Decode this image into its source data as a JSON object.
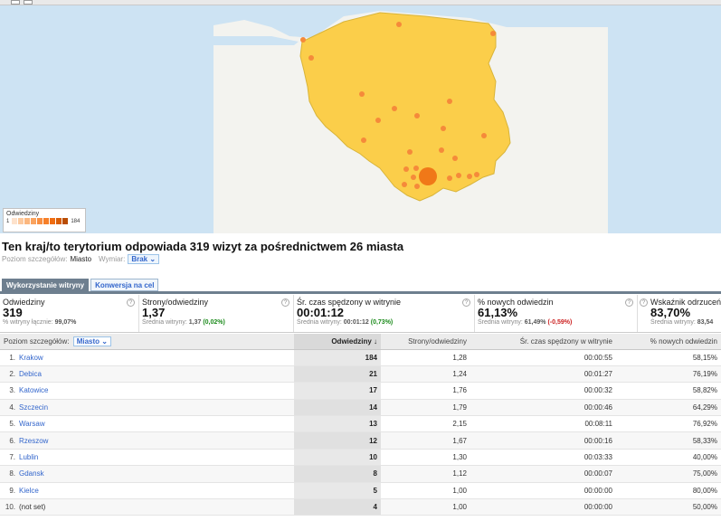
{
  "legend": {
    "title": "Odwiedziny",
    "min": "1",
    "max": "184"
  },
  "heading": "Ten kraj/to terytorium odpowiada 319 wizyt za pośrednictwem 26 miasta",
  "detail": {
    "level_label": "Poziom szczegółów:",
    "level_value": "Miasto",
    "dimension_label": "Wymiar:",
    "dimension_value": "Brak"
  },
  "tabs": [
    "Wykorzystanie witryny",
    "Konwersja na cel"
  ],
  "metrics": [
    {
      "title": "Odwiedziny",
      "value": "319",
      "sub_prefix": "% witryny łącznie:",
      "sub_value": "99,07%",
      "sub_delta": ""
    },
    {
      "title": "Strony/odwiedziny",
      "value": "1,37",
      "sub_prefix": "Średnia witryny:",
      "sub_value": "1,37",
      "sub_delta": "(0,02%)"
    },
    {
      "title": "Śr. czas spędzony w witrynie",
      "value": "00:01:12",
      "sub_prefix": "Średnia witryny:",
      "sub_value": "00:01:12",
      "sub_delta": "(0,73%)"
    },
    {
      "title": "% nowych odwiedzin",
      "value": "61,13%",
      "sub_prefix": "Średnia witryny:",
      "sub_value": "61,49%",
      "sub_delta": "(-0,59%)"
    },
    {
      "title": "Wskaźnik odrzuceń",
      "value": "83,70%",
      "sub_prefix": "Średnia witryny:",
      "sub_value": "83,54",
      "sub_delta": ""
    }
  ],
  "table": {
    "level_label": "Poziom szczegółów:",
    "level_value": "Miasto",
    "columns": [
      "Odwiedziny ↓",
      "Strony/odwiedziny",
      "Śr. czas spędzony w witrynie",
      "% nowych odwiedzin"
    ],
    "rows": [
      {
        "num": "1.",
        "city": "Krakow",
        "visits": "184",
        "pages": "1,28",
        "time": "00:00:55",
        "new": "58,15%"
      },
      {
        "num": "2.",
        "city": "Debica",
        "visits": "21",
        "pages": "1,24",
        "time": "00:01:27",
        "new": "76,19%"
      },
      {
        "num": "3.",
        "city": "Katowice",
        "visits": "17",
        "pages": "1,76",
        "time": "00:00:32",
        "new": "58,82%"
      },
      {
        "num": "4.",
        "city": "Szczecin",
        "visits": "14",
        "pages": "1,79",
        "time": "00:00:46",
        "new": "64,29%"
      },
      {
        "num": "5.",
        "city": "Warsaw",
        "visits": "13",
        "pages": "2,15",
        "time": "00:08:11",
        "new": "76,92%"
      },
      {
        "num": "6.",
        "city": "Rzeszow",
        "visits": "12",
        "pages": "1,67",
        "time": "00:00:16",
        "new": "58,33%"
      },
      {
        "num": "7.",
        "city": "Lublin",
        "visits": "10",
        "pages": "1,30",
        "time": "00:03:33",
        "new": "40,00%"
      },
      {
        "num": "8.",
        "city": "Gdansk",
        "visits": "8",
        "pages": "1,12",
        "time": "00:00:07",
        "new": "75,00%"
      },
      {
        "num": "9.",
        "city": "Kielce",
        "visits": "5",
        "pages": "1,00",
        "time": "00:00:00",
        "new": "80,00%"
      },
      {
        "num": "10.",
        "city": "(not set)",
        "visits": "4",
        "pages": "1,00",
        "time": "00:00:00",
        "new": "50,00%"
      }
    ]
  }
}
